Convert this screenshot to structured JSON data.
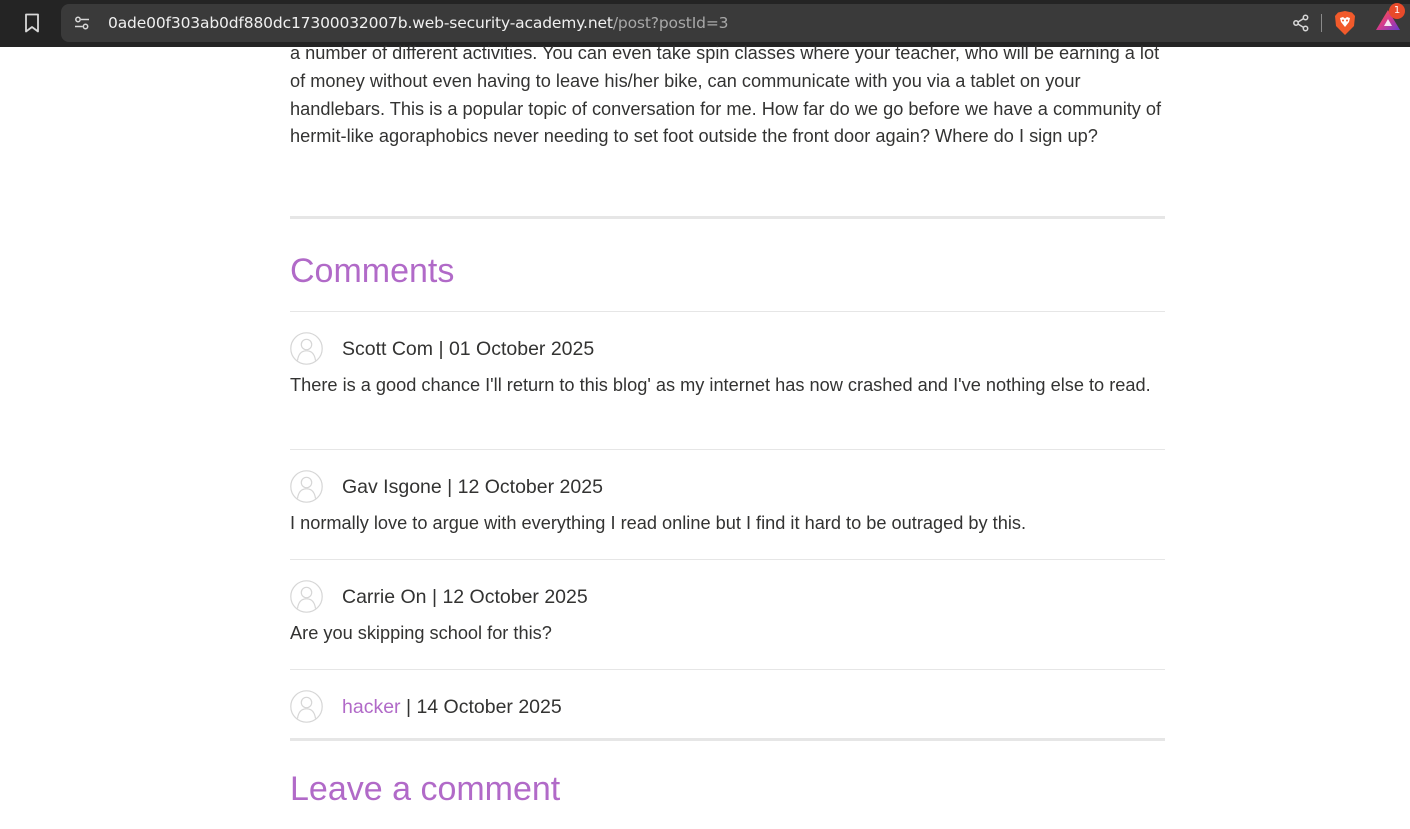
{
  "browser": {
    "url_host": "0ade00f303ab0df880dc17300032007b.web-security-academy.net",
    "url_path": "/post?postId=3",
    "rewards_badge": "1"
  },
  "post": {
    "body_tail": "a number of different activities. You can even take spin classes where your teacher, who will be earning a lot of money without even having to leave his/her bike, can communicate with you via a tablet on your handlebars. This is a popular topic of conversation for me. How far do we go before we have a community of hermit-like agoraphobics never needing to set foot outside the front door again? Where do I sign up?"
  },
  "comments_section": {
    "title": "Comments",
    "items": [
      {
        "author": "Scott Com",
        "separator": " | ",
        "date": "01 October 2025",
        "text": "There is a good chance I'll return to this blog' as my internet has now crashed and I've nothing else to read."
      },
      {
        "author": "Gav Isgone",
        "separator": " | ",
        "date": "12 October 2025",
        "text": "I normally love to argue with everything I read online but I find it hard to be outraged by this."
      },
      {
        "author": "Carrie On",
        "separator": " | ",
        "date": "12 October 2025",
        "text": "Are you skipping school for this?"
      },
      {
        "author": "hacker",
        "separator": " | ",
        "date": "14 October 2025",
        "text": ""
      }
    ]
  },
  "leave_comment": {
    "title": "Leave a comment"
  },
  "colors": {
    "accent": "#b16ac8",
    "text": "#333332",
    "divider": "#e6e6e6",
    "toolbar": "#242424"
  },
  "icons": {
    "bookmark": "bookmark-icon",
    "site_info": "site-info-icon",
    "share": "share-icon",
    "brave": "brave-shields-icon",
    "rewards": "brave-rewards-icon",
    "avatar": "user-avatar-icon"
  }
}
